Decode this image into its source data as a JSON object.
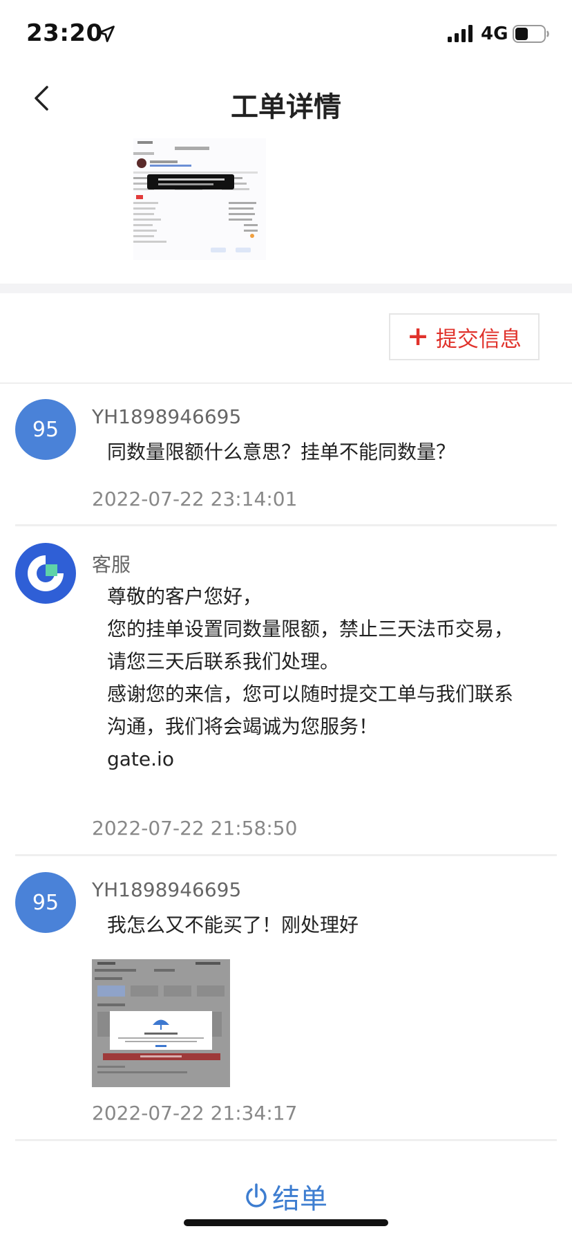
{
  "status_bar": {
    "time": "23:20",
    "network": "4G",
    "battery_level": 0.45
  },
  "nav": {
    "title": "工单详情"
  },
  "actions": {
    "submit_info_label": "提交信息",
    "close_ticket_label": "结单"
  },
  "colors": {
    "accent_red": "#e0322b",
    "accent_blue": "#3d7dd0",
    "avatar_blue": "#4a82d8"
  },
  "messages": [
    {
      "avatar_text": "95",
      "sender": "YH1898946695",
      "lines": [
        "同数量限额什么意思？挂单不能同数量？"
      ],
      "timestamp": "2022-07-22 23:14:01"
    },
    {
      "avatar_icon": "gate-logo-icon",
      "sender": "客服",
      "lines": [
        "尊敬的客户您好，",
        "您的挂单设置同数量限额，禁止三天法币交易，",
        "请您三天后联系我们处理。",
        "感谢您的来信，您可以随时提交工单与我们联系",
        "沟通，我们将会竭诚为您服务！",
        "gate.io"
      ],
      "timestamp": "2022-07-22 21:58:50"
    },
    {
      "avatar_text": "95",
      "sender": "YH1898946695",
      "lines": [
        "我怎么又不能买了！刚处理好"
      ],
      "timestamp": "2022-07-22 21:34:17"
    }
  ]
}
